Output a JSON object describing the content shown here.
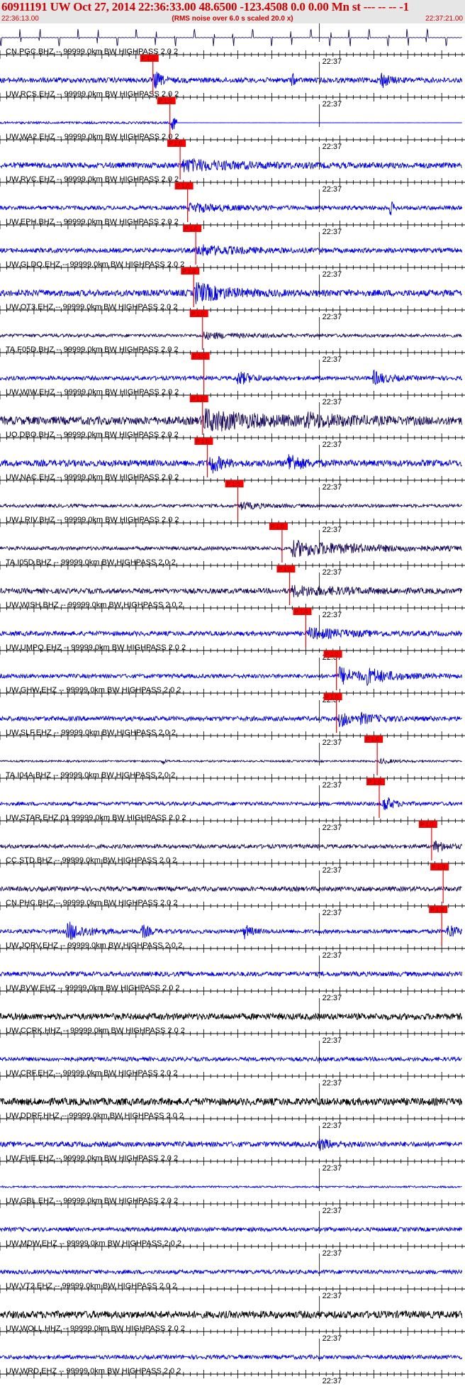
{
  "header": {
    "title": "60911191 UW Oct 27, 2014 22:36:33.00   48.6500 -123.4508  0.0 0.00 Mn st --- -- --   -1",
    "start_time": "22:36:13.00",
    "subtitle": "(RMS noise over 6.0 s scaled 20.0 x)",
    "end_time": "22:37:21.00"
  },
  "colors": {
    "header_bg": "#e6e6e6",
    "header_text": "#d40000",
    "pick": "#ff0000",
    "blue": "#0000ee",
    "navy": "#1a0a5e",
    "black": "#000000"
  },
  "chart_data": {
    "type": "seismogram",
    "time_range": [
      "22:36:13.00",
      "22:37:21.00"
    ],
    "minute_marker": "22:37",
    "pick_label": "P 1.0",
    "traces": [
      {
        "label": "CN.PGC.BHZ -- 99999.0km BW  HIGHPASS  2.0  2",
        "color": "navy",
        "pick": null,
        "noise": 0.12,
        "bursts": [],
        "kind": "pulses"
      },
      {
        "label": "UW.RCS.EHZ -- 99999.0km BW  HIGHPASS  2.0  2",
        "color": "blue",
        "pick": 22.5,
        "noise": 0.28,
        "bursts": [
          [
            22.8,
            1.0,
            0.8
          ],
          [
            43,
            0.7,
            0.3
          ],
          [
            56,
            0.9,
            1.0
          ]
        ],
        "kind": "noise"
      },
      {
        "label": "UW.WA2.EHZ -- 99999.0km BW  HIGHPASS  2.0  2",
        "color": "blue",
        "pick": 25.0,
        "noise": 0.12,
        "bursts": [
          [
            25.3,
            0.8,
            1.2
          ]
        ],
        "kind": "cut"
      },
      {
        "label": "UW.RVC.EHZ -- 99999.0km BW  HIGHPASS  2.0  2",
        "color": "blue",
        "pick": 26.5,
        "noise": 0.3,
        "bursts": [
          [
            27,
            0.55,
            8
          ]
        ],
        "kind": "noise"
      },
      {
        "label": "UW.EPH.BHZ -- 99999.0km BW  HIGHPASS  2.0  2",
        "color": "blue",
        "pick": 27.6,
        "noise": 0.22,
        "bursts": [
          [
            28,
            0.45,
            5
          ],
          [
            57.5,
            0.9,
            0.3
          ]
        ],
        "kind": "noise"
      },
      {
        "label": "UW.GLDO.EHZ -- 99999.0km BW  HIGHPASS  2.0  2",
        "color": "blue",
        "pick": 28.8,
        "noise": 0.25,
        "bursts": [
          [
            29,
            0.5,
            6
          ]
        ],
        "kind": "noise"
      },
      {
        "label": "UW.OT3.EHZ -- 99999.0km BW  HIGHPASS  2.0  2",
        "color": "blue",
        "pick": 28.5,
        "noise": 0.35,
        "bursts": [
          [
            28.8,
            1.0,
            4
          ]
        ],
        "kind": "noise"
      },
      {
        "label": "TA.F05D.BHZ -- 99999.0km BW  HIGHPASS  2.0  2",
        "color": "navy",
        "pick": 29.8,
        "noise": 0.18,
        "bursts": [
          [
            30,
            0.3,
            5
          ]
        ],
        "kind": "noise"
      },
      {
        "label": "UW.WIW.EHZ -- 99999.0km BW  HIGHPASS  2.0  2",
        "color": "blue",
        "pick": 30.0,
        "noise": 0.22,
        "bursts": [
          [
            35,
            0.7,
            2
          ],
          [
            55,
            0.7,
            2
          ]
        ],
        "kind": "noise"
      },
      {
        "label": "UO.DBO.BHZ -- 99999.0km BW  HIGHPASS  2.0  2",
        "color": "navy",
        "pick": 29.8,
        "noise": 0.45,
        "bursts": [
          [
            30,
            1.0,
            8
          ],
          [
            45,
            0.5,
            5
          ]
        ],
        "kind": "noise"
      },
      {
        "label": "UW.NAC.EHZ -- 99999.0km BW  HIGHPASS  2.0  2",
        "color": "blue",
        "pick": 30.5,
        "noise": 0.35,
        "bursts": [
          [
            31,
            1.0,
            1.5
          ],
          [
            42.5,
            1.1,
            1.5
          ]
        ],
        "kind": "noise"
      },
      {
        "label": "UW.LRIV.BHZ -- 99999.0km BW  HIGHPASS  2.0  2",
        "color": "navy",
        "pick": 35.0,
        "noise": 0.18,
        "bursts": [
          [
            35.5,
            0.35,
            3
          ]
        ],
        "kind": "noise"
      },
      {
        "label": "TA.I05D.BHZ -- 99999.0km BW  HIGHPASS  2.0  2",
        "color": "navy",
        "pick": 41.5,
        "noise": 0.2,
        "bursts": [
          [
            43,
            0.8,
            10
          ]
        ],
        "kind": "noise"
      },
      {
        "label": "UW.WISH.BHZ -- 99999.0km BW  HIGHPASS  2.0  2",
        "color": "navy",
        "pick": 42.6,
        "noise": 0.28,
        "bursts": [
          [
            43,
            0.45,
            8
          ]
        ],
        "kind": "noise"
      },
      {
        "label": "UW.UMPQ.EHZ -- 99999.0km BW  HIGHPASS  2.0  2",
        "color": "blue",
        "pick": 45.0,
        "noise": 0.25,
        "bursts": [
          [
            45.5,
            0.5,
            6
          ]
        ],
        "kind": "noise"
      },
      {
        "label": "UW.GHW.EHZ -- 99999.0km BW  HIGHPASS  2.0  2",
        "color": "blue",
        "pick": 49.5,
        "noise": 0.22,
        "bursts": [
          [
            50,
            0.9,
            3
          ],
          [
            54,
            0.6,
            4
          ]
        ],
        "kind": "noise"
      },
      {
        "label": "UW.SLF.EHZ -- 99999.0km BW  HIGHPASS  2.0  2",
        "color": "blue",
        "pick": 49.5,
        "noise": 0.25,
        "bursts": [
          [
            50,
            0.9,
            1.5
          ],
          [
            53,
            0.4,
            3
          ]
        ],
        "kind": "noise"
      },
      {
        "label": "TA.I04A.BHZ -- 99999.0km BW  HIGHPASS  2.0  2",
        "color": "navy",
        "pick": 55.5,
        "noise": 0.1,
        "bursts": [
          [
            24,
            0.35,
            0.4
          ],
          [
            56,
            0.25,
            2
          ]
        ],
        "kind": "noise"
      },
      {
        "label": "UW.STAR.EHZ.01 99999.0km BW  HIGHPASS  2.0  2",
        "color": "blue",
        "pick": 55.8,
        "noise": 0.2,
        "bursts": [
          [
            56.5,
            0.9,
            1.2
          ]
        ],
        "kind": "noise"
      },
      {
        "label": "CC.STD.BHZ -- 99999.0km BW  HIGHPASS  2.0  2",
        "color": "navy",
        "pick": 63.5,
        "noise": 0.22,
        "bursts": [
          [
            64,
            0.6,
            1.5
          ]
        ],
        "kind": "noise"
      },
      {
        "label": "CN.PHC.BHZ -- 99999.0km BW  HIGHPASS  2.0  2",
        "color": "navy",
        "pick": 65.2,
        "noise": 0.25,
        "bursts": [],
        "kind": "noise"
      },
      {
        "label": "UW.JORV.EHZ -- 99999.0km BW  HIGHPASS  2.0  2",
        "color": "blue",
        "pick": 65.0,
        "noise": 0.22,
        "bursts": [
          [
            10,
            1.0,
            2.5
          ],
          [
            21,
            0.7,
            1
          ],
          [
            36,
            0.7,
            1
          ],
          [
            66,
            0.9,
            1
          ]
        ],
        "kind": "noise"
      },
      {
        "label": "UW.BVW.EHZ -- 99999.0km BW  HIGHPASS  2.0  2",
        "color": "blue",
        "pick": null,
        "noise": 0.25,
        "bursts": [],
        "kind": "noise"
      },
      {
        "label": "UW.CCRK.HHZ -- 99999.0km BW  HIGHPASS  2.0  2",
        "color": "black",
        "pick": null,
        "noise": 0.35,
        "bursts": [],
        "kind": "noise"
      },
      {
        "label": "UW.CRF.EHZ -- 99999.0km BW  HIGHPASS  2.0  2",
        "color": "blue",
        "pick": null,
        "noise": 0.22,
        "bursts": [],
        "kind": "noise"
      },
      {
        "label": "UW.DDRF.HHZ -- 99999.0km BW  HIGHPASS  2.0  2",
        "color": "black",
        "pick": null,
        "noise": 0.4,
        "bursts": [],
        "kind": "noise"
      },
      {
        "label": "UW.FHE.EHZ -- 99999.0km BW  HIGHPASS  2.0  2",
        "color": "blue",
        "pick": null,
        "noise": 0.28,
        "bursts": [
          [
            47,
            0.5,
            2
          ]
        ],
        "kind": "noise"
      },
      {
        "label": "UW.GBL.EHZ -- 99999.0km BW  HIGHPASS  2.0  2",
        "color": "blue",
        "pick": null,
        "noise": 0.1,
        "bursts": [],
        "kind": "noise"
      },
      {
        "label": "UW.MDW.EHZ -- 99999.0km BW  HIGHPASS  2.0  2",
        "color": "blue",
        "pick": null,
        "noise": 0.22,
        "bursts": [],
        "kind": "noise"
      },
      {
        "label": "UW.VT2.EHZ -- 99999.0km BW  HIGHPASS  2.0  2",
        "color": "blue",
        "pick": null,
        "noise": 0.22,
        "bursts": [],
        "kind": "noise"
      },
      {
        "label": "UW.WOLL.HHZ -- 99999.0km BW  HIGHPASS  2.0  2",
        "color": "black",
        "pick": null,
        "noise": 0.4,
        "bursts": [],
        "kind": "noise"
      },
      {
        "label": "UW.WRD.EHZ -- 99999.0km BW  HIGHPASS  2.0  2",
        "color": "blue",
        "pick": null,
        "noise": 0.22,
        "bursts": [],
        "kind": "noise"
      }
    ]
  }
}
